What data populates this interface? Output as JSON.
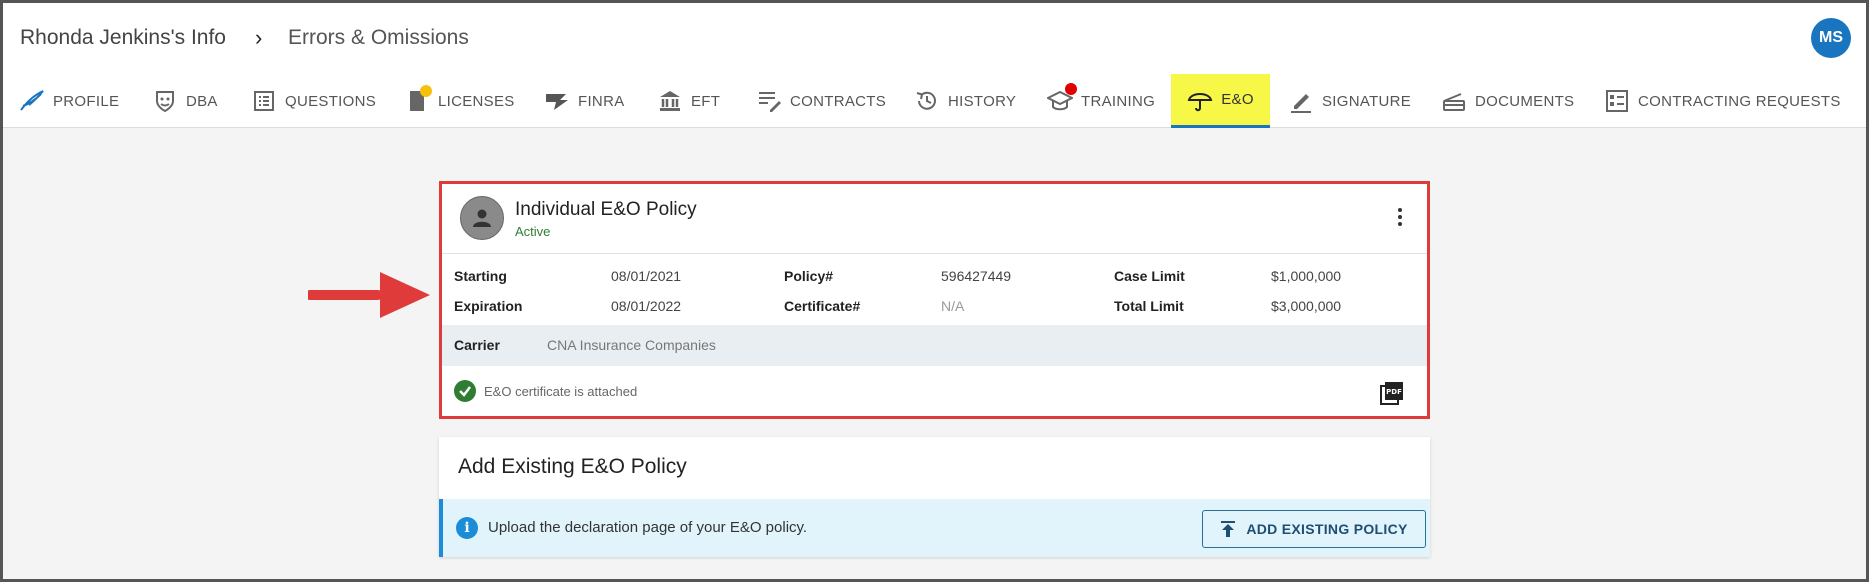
{
  "breadcrumb": {
    "parent": "Rhonda Jenkins's Info",
    "current": "Errors & Omissions"
  },
  "user": {
    "initials": "MS"
  },
  "tabs": [
    {
      "label": "PROFILE",
      "icon": "feather-icon"
    },
    {
      "label": "DBA",
      "icon": "theater-mask-icon"
    },
    {
      "label": "QUESTIONS",
      "icon": "list-icon"
    },
    {
      "label": "LICENSES",
      "icon": "license-icon",
      "badge": "#f4c20d"
    },
    {
      "label": "FINRA",
      "icon": "finra-icon"
    },
    {
      "label": "EFT",
      "icon": "bank-icon"
    },
    {
      "label": "CONTRACTS",
      "icon": "edit-note-icon"
    },
    {
      "label": "HISTORY",
      "icon": "history-icon"
    },
    {
      "label": "TRAINING",
      "icon": "graduation-cap-icon",
      "badge": "#e00000"
    },
    {
      "label": "E&O",
      "icon": "umbrella-icon",
      "active": true
    },
    {
      "label": "SIGNATURE",
      "icon": "pen-icon"
    },
    {
      "label": "DOCUMENTS",
      "icon": "tray-icon"
    },
    {
      "label": "CONTRACTING REQUESTS",
      "icon": "request-list-icon"
    }
  ],
  "policy": {
    "title": "Individual E&O Policy",
    "status": "Active",
    "starting_label": "Starting",
    "starting": "08/01/2021",
    "expiration_label": "Expiration",
    "expiration": "08/01/2022",
    "policy_no_label": "Policy#",
    "policy_no": "596427449",
    "certificate_label": "Certificate#",
    "certificate": "N/A",
    "case_limit_label": "Case Limit",
    "case_limit": "$1,000,000",
    "total_limit_label": "Total Limit",
    "total_limit": "$3,000,000",
    "carrier_label": "Carrier",
    "carrier": "CNA Insurance Companies",
    "attachment_text": "E&O certificate is attached"
  },
  "add_existing": {
    "title": "Add Existing E&O Policy",
    "info_text": "Upload the declaration page of your E&O policy.",
    "button_label": "ADD EXISTING POLICY"
  },
  "colors": {
    "accent": "#1a75c1",
    "active_tab_bg": "#f7f748",
    "highlight_border": "#e03b3b",
    "status_green": "#2e7d32"
  }
}
